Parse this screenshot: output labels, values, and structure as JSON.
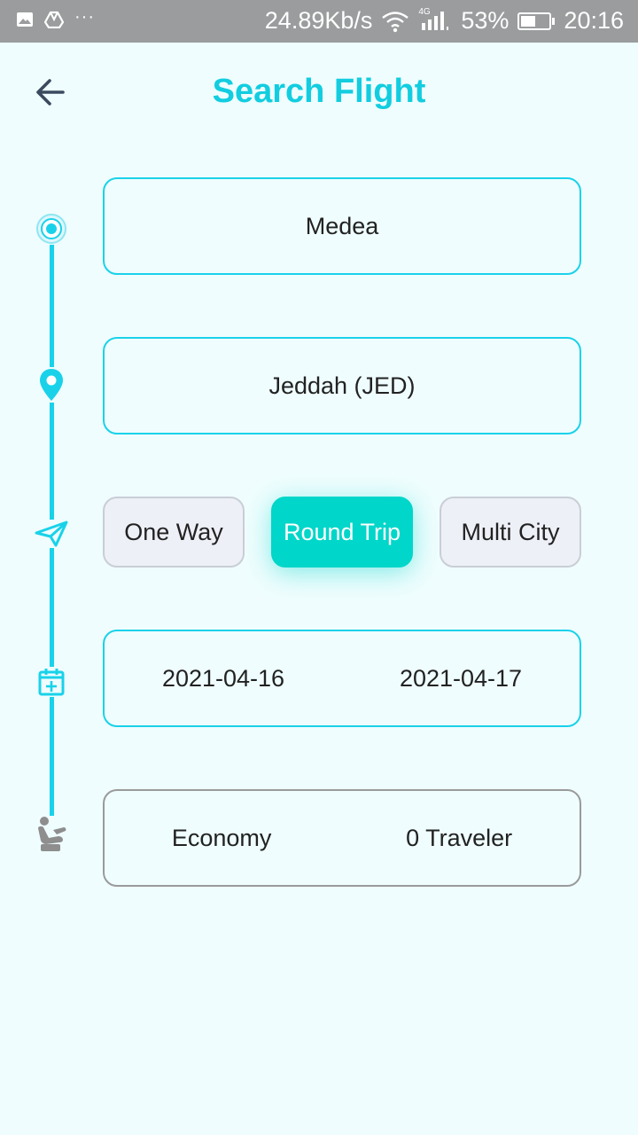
{
  "status_bar": {
    "net_speed": "24.89Kb/s",
    "network_type": "4G",
    "battery_percent": "53%",
    "battery_level": 0.53,
    "time": "20:16",
    "left_icons": [
      "image-icon",
      "drive-icon",
      "more-dots-icon"
    ],
    "more_dots": "···"
  },
  "header": {
    "title": "Search Flight",
    "back_icon": "arrow-left-icon"
  },
  "timeline": {
    "color": "#19d2ea",
    "icons": [
      "origin-target-icon",
      "destination-pin-icon",
      "paper-plane-icon",
      "calendar-add-icon",
      "seat-icon"
    ]
  },
  "form": {
    "origin": "Medea",
    "destination": "Jeddah (JED)",
    "trip_types": [
      {
        "label": "One Way",
        "selected": false
      },
      {
        "label": "Round Trip",
        "selected": true
      },
      {
        "label": "Multi City",
        "selected": false
      }
    ],
    "depart_date": "2021-04-16",
    "return_date": "2021-04-17",
    "cabin_class": "Economy",
    "travelers": "0 Traveler"
  },
  "colors": {
    "accent": "#12cde0",
    "selected": "#00d6c9",
    "background": "#effdfe",
    "status_bar": "#9a9c9d"
  }
}
